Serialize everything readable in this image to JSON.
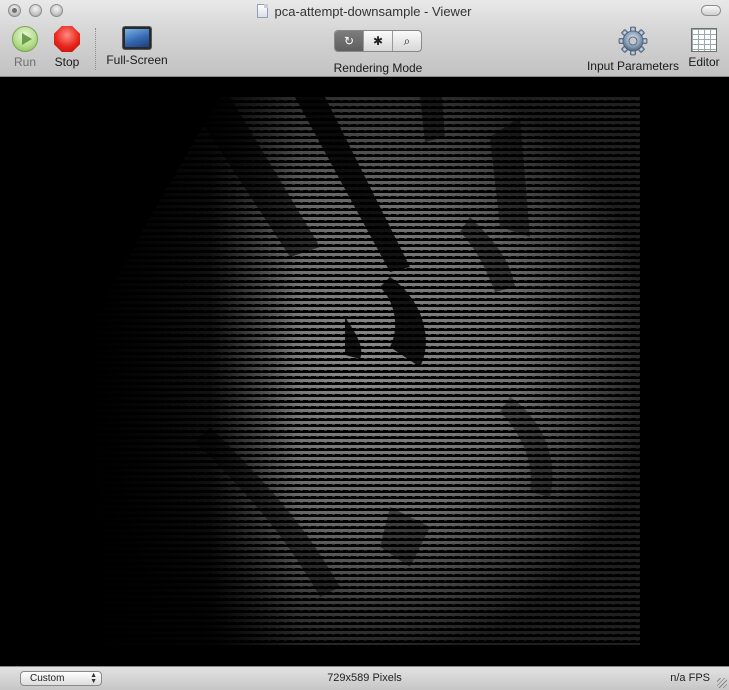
{
  "window": {
    "title": "pca-attempt-downsample - Viewer"
  },
  "toolbar": {
    "run_label": "Run",
    "stop_label": "Stop",
    "fullscreen_label": "Full-Screen",
    "rendering_mode_label": "Rendering Mode",
    "rendering_modes": [
      {
        "icon": "reload-icon",
        "glyph": "↻",
        "active": true
      },
      {
        "icon": "bug-icon",
        "glyph": "✱",
        "active": false
      },
      {
        "icon": "magnifier-icon",
        "glyph": "⌕",
        "active": false
      }
    ],
    "input_parameters_label": "Input Parameters",
    "editor_label": "Editor"
  },
  "status": {
    "preset_value": "Custom",
    "dimensions": "729x589 Pixels",
    "fps": "n/a FPS"
  },
  "colors": {
    "run_green": "#8cc35a",
    "stop_red": "#e8261c",
    "viewer_background": "#000000"
  }
}
